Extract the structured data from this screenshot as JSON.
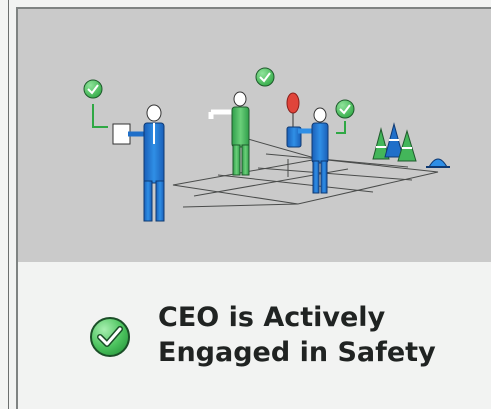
{
  "card": {
    "illustration_alt": "",
    "caption": {
      "icon": "check-circle-icon",
      "title": "CEO is Actively Engaged in Safety"
    }
  },
  "colors": {
    "illustration_bg": "#cacaca",
    "caption_bg": "#f2f3f2",
    "check_green": "#3cc04a",
    "title_text": "#202322",
    "worker_blue": "#1f6fc9",
    "worker_green": "#43b65a",
    "balloon_red": "#e0443a"
  }
}
